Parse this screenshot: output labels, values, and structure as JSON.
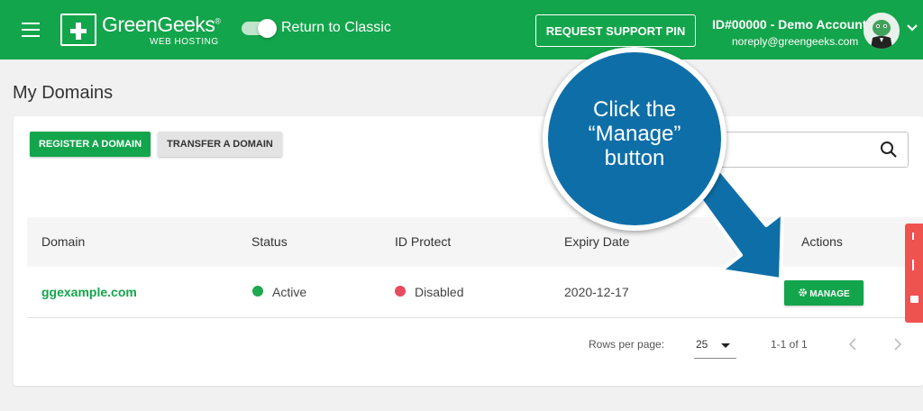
{
  "header": {
    "logo_text": "GreenGeeks",
    "logo_registered": "®",
    "logo_subtext": "WEB HOSTING",
    "toggle_label": "Return to Classic",
    "support_button": "REQUEST SUPPORT PIN",
    "account_name": "ID#00000 - Demo Account",
    "account_email": "noreply@greengeeks.com",
    "brand_color": "#13a54b"
  },
  "page": {
    "title": "My Domains",
    "register_button": "REGISTER A DOMAIN",
    "transfer_button": "TRANSFER A DOMAIN",
    "search_placeholder": ""
  },
  "table": {
    "columns": [
      "Domain",
      "Status",
      "ID Protect",
      "Expiry Date",
      "Actions"
    ],
    "rows": [
      {
        "domain": "ggexample.com",
        "status": "Active",
        "status_color": "#1ea84f",
        "id_protect": "Disabled",
        "id_protect_color": "#e84a5f",
        "expiry": "2020-12-17",
        "action": "MANAGE"
      }
    ]
  },
  "pagination": {
    "rows_per_page_label": "Rows per page:",
    "rows_per_page_value": "25",
    "range": "1-1 of 1"
  },
  "callout": {
    "line1": "Click the",
    "line2": "“Manage”",
    "line3": "button",
    "color": "#0e6fa8"
  }
}
